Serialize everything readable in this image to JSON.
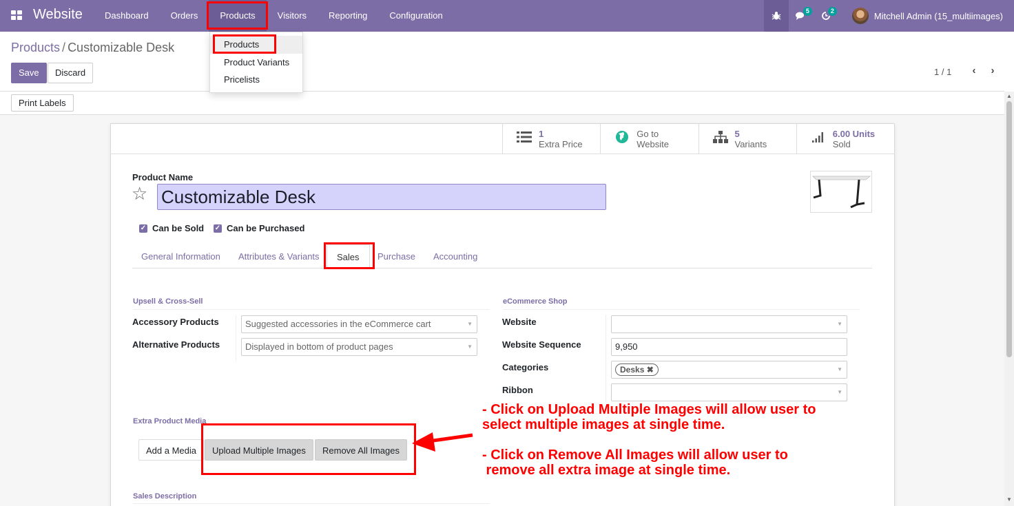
{
  "navbar": {
    "app_name": "Website",
    "menu": [
      "Dashboard",
      "Orders",
      "Products",
      "Visitors",
      "Reporting",
      "Configuration"
    ],
    "chat_count": "5",
    "activity_count": "2",
    "user_name": "Mitchell Admin (15_multiimages)"
  },
  "dropdown": [
    "Products",
    "Product Variants",
    "Pricelists"
  ],
  "breadcrumb": {
    "parent": "Products",
    "current": "Customizable Desk"
  },
  "buttons": {
    "save": "Save",
    "discard": "Discard",
    "print_labels": "Print Labels"
  },
  "pager": "1 / 1",
  "smart_buttons": [
    {
      "value": "1",
      "label": "Extra Price",
      "icon": "list-icon"
    },
    {
      "value": "Go to",
      "label": "Website",
      "icon": "globe-icon"
    },
    {
      "value": "5",
      "label": "Variants",
      "icon": "sitemap-icon"
    },
    {
      "value": "6.00 Units",
      "label": "Sold",
      "icon": "signal-icon"
    }
  ],
  "product": {
    "name_label": "Product Name",
    "name": "Customizable Desk",
    "can_be_sold": "Can be Sold",
    "can_be_purchased": "Can be Purchased"
  },
  "tabs": [
    "General Information",
    "Attributes & Variants",
    "Sales",
    "Purchase",
    "Accounting"
  ],
  "sales": {
    "upsell_title": "Upsell & Cross-Sell",
    "accessory_label": "Accessory Products",
    "accessory_placeholder": "Suggested accessories in the eCommerce cart",
    "alternative_label": "Alternative Products",
    "alternative_placeholder": "Displayed in bottom of product pages",
    "ecommerce_title": "eCommerce Shop",
    "website_label": "Website",
    "sequence_label": "Website Sequence",
    "sequence_value": "9,950",
    "categories_label": "Categories",
    "category_tag": "Desks",
    "ribbon_label": "Ribbon",
    "media_title": "Extra Product Media",
    "add_media": "Add a Media",
    "upload_multiple": "Upload Multiple Images",
    "remove_all": "Remove All Images",
    "sales_description": "Sales Description"
  },
  "annotations": {
    "line1": "- Click on Upload Multiple Images will allow user to",
    "line2": "select multiple images at single time.",
    "line3": "- Click on Remove All Images will allow user to",
    "line4": " remove all extra image at single time."
  },
  "colors": {
    "brand": "#7c6da6",
    "annotation": "#ff0000"
  }
}
